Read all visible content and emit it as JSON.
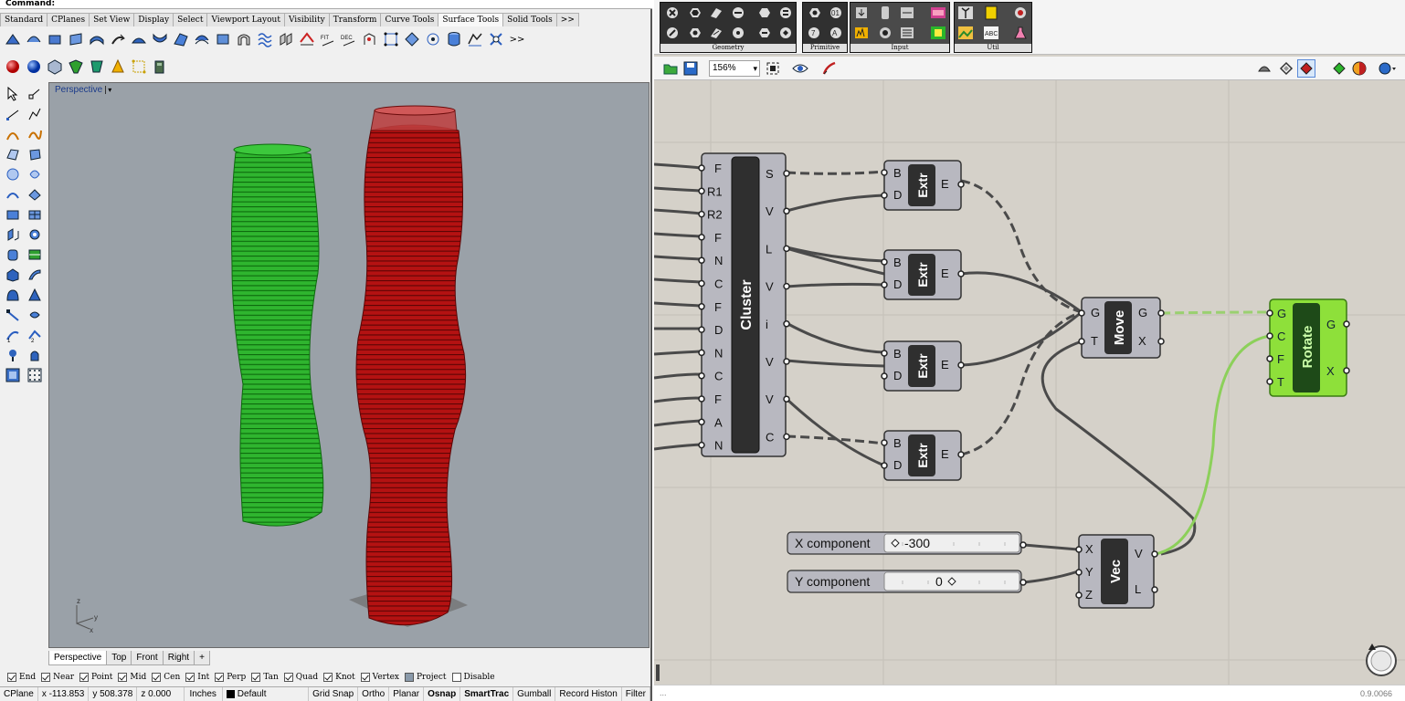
{
  "rhino": {
    "command_label": "Command:",
    "tabs": [
      "Standard",
      "CPlanes",
      "Set View",
      "Display",
      "Select",
      "Viewport Layout",
      "Visibility",
      "Transform",
      "Curve Tools",
      "Surface Tools",
      "Solid Tools"
    ],
    "tabs_more": ">>",
    "toolbar_more": ">>",
    "viewport": {
      "title": "Perspective",
      "menu_arrow": "▾",
      "axis_z": "z",
      "axis_y": "y",
      "axis_x": "x"
    },
    "viewport_tabs": [
      "Perspective",
      "Top",
      "Front",
      "Right"
    ],
    "add_tab_icon": "+",
    "osnaps": [
      {
        "label": "End",
        "checked": true
      },
      {
        "label": "Near",
        "checked": true
      },
      {
        "label": "Point",
        "checked": true
      },
      {
        "label": "Mid",
        "checked": true
      },
      {
        "label": "Cen",
        "checked": true
      },
      {
        "label": "Int",
        "checked": true
      },
      {
        "label": "Perp",
        "checked": true
      },
      {
        "label": "Tan",
        "checked": true
      },
      {
        "label": "Quad",
        "checked": true
      },
      {
        "label": "Knot",
        "checked": true
      },
      {
        "label": "Vertex",
        "checked": true
      },
      {
        "label": "Project",
        "checked": false
      },
      {
        "label": "Disable",
        "checked": false
      }
    ],
    "status": {
      "cplane": "CPlane",
      "x": "x -113.853",
      "y": "y 508.378",
      "z": "z 0.000",
      "units": "Inches",
      "layer": "Default",
      "grid_snap": "Grid Snap",
      "ortho": "Ortho",
      "planar": "Planar",
      "osnap": "Osnap",
      "smarttrack": "SmartTrac",
      "gumball": "Gumball",
      "record_history": "Record Histon",
      "filter": "Filter"
    },
    "colors": {
      "green_tower": "#1fa51f",
      "red_tower": "#a01010",
      "viewport_bg": "#9aa1a8"
    }
  },
  "grasshopper": {
    "tab_groups": [
      "Geometry",
      "Primitive",
      "Input",
      "Util"
    ],
    "zoom": "156%",
    "version": "0.9.0066",
    "status_left": "...",
    "components": {
      "cluster": {
        "name": "Cluster",
        "inputs": [
          "F",
          "R1",
          "R2",
          "F",
          "N",
          "C",
          "F",
          "D",
          "N",
          "C",
          "F",
          "A",
          "N"
        ],
        "outputs": [
          "S",
          "V",
          "L",
          "V",
          "i",
          "V",
          "V",
          "C"
        ]
      },
      "extr1": {
        "name": "Extr",
        "inputs": [
          "B",
          "D"
        ],
        "outputs": [
          "E"
        ]
      },
      "extr2": {
        "name": "Extr",
        "inputs": [
          "B",
          "D"
        ],
        "outputs": [
          "E"
        ]
      },
      "extr3": {
        "name": "Extr",
        "inputs": [
          "B",
          "D"
        ],
        "outputs": [
          "E"
        ]
      },
      "extr4": {
        "name": "Extr",
        "inputs": [
          "B",
          "D"
        ],
        "outputs": [
          "E"
        ]
      },
      "move": {
        "name": "Move",
        "inputs": [
          "G",
          "T"
        ],
        "outputs": [
          "G",
          "X"
        ]
      },
      "rotate": {
        "name": "Rotate",
        "inputs": [
          "G",
          "C",
          "F",
          "T"
        ],
        "outputs": [
          "G",
          "X"
        ]
      },
      "vec": {
        "name": "Vec",
        "inputs": [
          "X",
          "Y",
          "Z"
        ],
        "outputs": [
          "V",
          "L"
        ]
      }
    },
    "sliders": [
      {
        "label": "X component",
        "value": "-300"
      },
      {
        "label": "Y component",
        "value": "0"
      }
    ],
    "colors": {
      "canvas": "#d5d1c9",
      "component": "#b9b9c0",
      "selected": "#8fe03c",
      "wire": "#4a4a4a",
      "wire_selected": "#88c858"
    }
  }
}
